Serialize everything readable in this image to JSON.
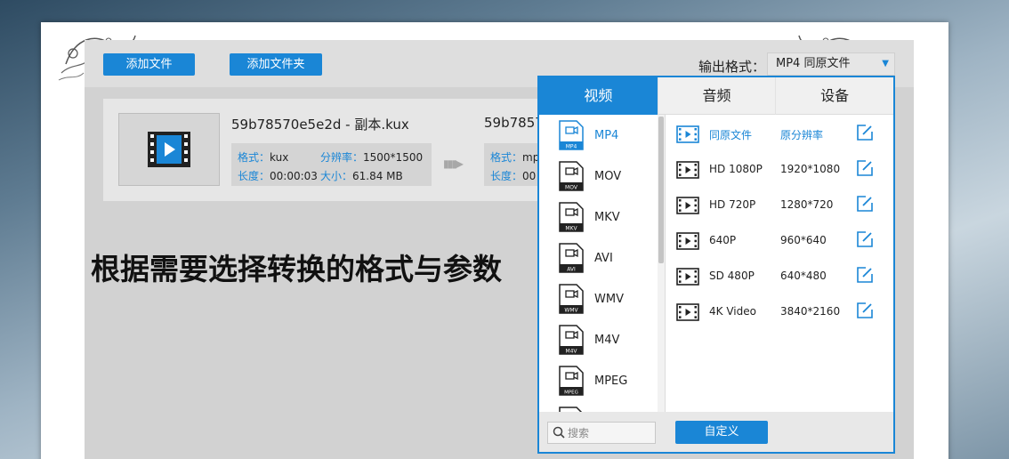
{
  "toolbar": {
    "add_file_label": "添加文件",
    "add_folder_label": "添加文件夹",
    "output_format_label": "输出格式：",
    "output_format_value": "MP4  同原文件"
  },
  "file": {
    "source_name": "59b78570e5e2d - 副本.kux",
    "target_name": "59b7857",
    "source_info": {
      "format_key": "格式：",
      "format_val": "kux",
      "resolution_key": "分辨率：",
      "resolution_val": "1500*1500",
      "length_key": "长度：",
      "length_val": "00:00:03",
      "size_key": "大小：",
      "size_val": "61.84 MB"
    },
    "target_info": {
      "format_key": "格式：",
      "format_val": "mp",
      "length_key": "长度：",
      "length_val": "00"
    }
  },
  "caption": "根据需要选择转换的格式与参数",
  "panel": {
    "tabs": [
      {
        "label": "视频"
      },
      {
        "label": "音频"
      },
      {
        "label": "设备"
      }
    ],
    "formats": [
      {
        "label": "MP4",
        "badge": "MP4"
      },
      {
        "label": "MOV",
        "badge": "MOV"
      },
      {
        "label": "MKV",
        "badge": "MKV"
      },
      {
        "label": "AVI",
        "badge": "AVI"
      },
      {
        "label": "WMV",
        "badge": "WMV"
      },
      {
        "label": "M4V",
        "badge": "M4V"
      },
      {
        "label": "MPEG",
        "badge": "MPEG"
      }
    ],
    "presets": [
      {
        "name": "同原文件",
        "res": "原分辨率"
      },
      {
        "name": "HD 1080P",
        "res": "1920*1080"
      },
      {
        "name": "HD 720P",
        "res": "1280*720"
      },
      {
        "name": "640P",
        "res": "960*640"
      },
      {
        "name": "SD 480P",
        "res": "640*480"
      },
      {
        "name": "4K Video",
        "res": "3840*2160"
      }
    ],
    "search_placeholder": "搜索",
    "custom_label": "自定义"
  },
  "colors": {
    "accent": "#1a86d6"
  }
}
